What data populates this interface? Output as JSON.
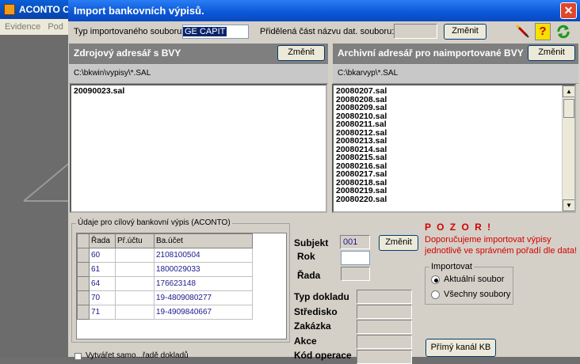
{
  "background_app": {
    "title": "ACONTO C",
    "menu": [
      "Evidence",
      "Pod"
    ]
  },
  "dialog": {
    "title": "Import bankovních výpisů.",
    "close_label": "✕",
    "import_type_label": "Typ importovaného souboru",
    "import_type_value": "GE CAPIT",
    "assigned_part_label": "Přidělená část názvu dat. souboru:",
    "assigned_part_value": "",
    "change_label": "Změnit"
  },
  "source_panel": {
    "title": "Zdrojový adresář s BVY",
    "change_label": "Změnit",
    "path": "C:\\bkwin\\vypisy\\*.SAL",
    "files": [
      "20090023.sal"
    ]
  },
  "archive_panel": {
    "title": "Archivní adresář pro naimportované BVY",
    "change_label": "Změnit",
    "path": "C:\\bkarvyp\\*.SAL",
    "files": [
      "20080207.sal",
      "20080208.sal",
      "20080209.sal",
      "20080210.sal",
      "20080211.sal",
      "20080212.sal",
      "20080213.sal",
      "20080214.sal",
      "20080215.sal",
      "20080216.sal",
      "20080217.sal",
      "20080218.sal",
      "20080219.sal",
      "20080220.sal"
    ]
  },
  "target_group": {
    "title": "Údaje pro cílový bankovní výpis (ACONTO)",
    "columns": [
      "Řada",
      "Př.účtu",
      "Ba.účet"
    ],
    "rows": [
      {
        "rada": "60",
        "pr_uctu": "",
        "ba_ucet": "2108100504"
      },
      {
        "rada": "61",
        "pr_uctu": "",
        "ba_ucet": "1800029033"
      },
      {
        "rada": "64",
        "pr_uctu": "",
        "ba_ucet": "176623148"
      },
      {
        "rada": "70",
        "pr_uctu": "",
        "ba_ucet": "19-4809080277"
      },
      {
        "rada": "71",
        "pr_uctu": "",
        "ba_ucet": "19-4909840667"
      }
    ]
  },
  "subject": {
    "subjekt_label": "Subjekt",
    "subjekt_value": "001",
    "change_label": "Změnit",
    "rok_label": "Rok",
    "rok_value": "",
    "rada_label": "Řada",
    "rada_value": ""
  },
  "doc_fields": {
    "typ_dokladu": "Typ dokladu",
    "stredisko": "Středisko",
    "zakazka": "Zakázka",
    "akce": "Akce",
    "kod_operace": "Kód operace"
  },
  "warning": {
    "title": "P O Z O R !",
    "text_line1": "Doporučujeme importovat výpisy",
    "text_line2": "jednotlivě ve správném pořadí dle data!"
  },
  "import_group": {
    "title": "Importovat",
    "options": [
      "Aktuální soubor",
      "Všechny soubory"
    ],
    "selected": "Aktuální soubor"
  },
  "direct_channel_label": "Přímý kanál KB",
  "bottom_checkbox_label": "Vytvářet samo...řadě dokladů"
}
